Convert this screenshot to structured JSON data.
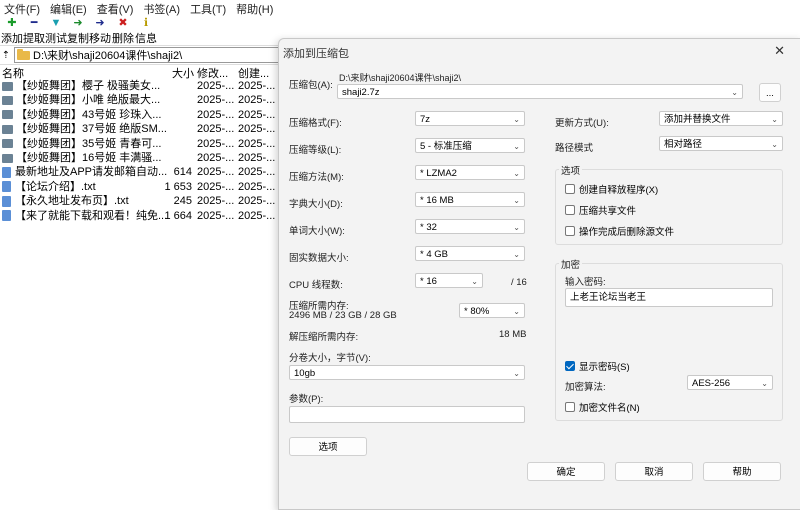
{
  "menu": [
    "文件(F)",
    "编辑(E)",
    "查看(V)",
    "书签(A)",
    "工具(T)",
    "帮助(H)"
  ],
  "toolbar": {
    "add": "添加",
    "extract": "提取",
    "test": "测试",
    "copy": "复制",
    "move": "移动",
    "delete": "删除",
    "info": "信息"
  },
  "address": "D:\\来财\\shaji20604课件\\shaji2\\",
  "list": {
    "headers": {
      "name": "名称",
      "size": "大小",
      "modified": "修改...",
      "created": "创建..."
    },
    "rows": [
      {
        "name": "【纱姬舞团】樱子 极骚美女...",
        "size": "",
        "modified": "2025-...",
        "created": "2025-...",
        "type": "folder"
      },
      {
        "name": "【纱姬舞团】小唯 绝版最大...",
        "size": "",
        "modified": "2025-...",
        "created": "2025-...",
        "type": "folder"
      },
      {
        "name": "【纱姬舞团】43号姬 珍珠入...",
        "size": "",
        "modified": "2025-...",
        "created": "2025-...",
        "type": "folder"
      },
      {
        "name": "【纱姬舞团】37号姬 绝版SM...",
        "size": "",
        "modified": "2025-...",
        "created": "2025-...",
        "type": "folder"
      },
      {
        "name": "【纱姬舞团】35号姬 青春可...",
        "size": "",
        "modified": "2025-...",
        "created": "2025-...",
        "type": "folder"
      },
      {
        "name": "【纱姬舞团】16号姬 丰满骚...",
        "size": "",
        "modified": "2025-...",
        "created": "2025-...",
        "type": "folder"
      },
      {
        "name": "最新地址及APP请发邮箱自动...",
        "size": "614",
        "modified": "2025-...",
        "created": "2025-...",
        "type": "file"
      },
      {
        "name": "【论坛介绍】.txt",
        "size": "1 653",
        "modified": "2025-...",
        "created": "2025-...",
        "type": "file"
      },
      {
        "name": "【永久地址发布页】.txt",
        "size": "245",
        "modified": "2025-...",
        "created": "2025-...",
        "type": "file"
      },
      {
        "name": "【来了就能下载和观看！纯免...",
        "size": "1 664",
        "modified": "2025-...",
        "created": "2025-...",
        "type": "file"
      }
    ]
  },
  "dialog": {
    "title": "添加到压缩包",
    "archive_label": "压缩包(A):",
    "archive_path": "D:\\来财\\shaji20604课件\\shaji2\\",
    "archive_name": "shaji2.7z",
    "browse": "...",
    "format_label": "压缩格式(F):",
    "format_value": "7z",
    "level_label": "压缩等级(L):",
    "level_value": "5 - 标准压缩",
    "method_label": "压缩方法(M):",
    "method_value": "*  LZMA2",
    "dict_label": "字典大小(D):",
    "dict_value": "*  16 MB",
    "word_label": "单词大小(W):",
    "word_value": "*  32",
    "solid_label": "固实数据大小:",
    "solid_value": "*  4 GB",
    "cpu_label": "CPU 线程数:",
    "cpu_value": "*  16",
    "cpu_max": "/ 16",
    "mem_comp_label": "压缩所需内存:",
    "mem_comp_value": "2496 MB / 23 GB / 28 GB",
    "mem_percent": "* 80%",
    "mem_decomp_label": "解压缩所需内存:",
    "mem_decomp_value": "18 MB",
    "split_label": "分卷大小，字节(V):",
    "split_value": "10gb",
    "params_label": "参数(P):",
    "params_value": "",
    "options_button": "选项",
    "update_label": "更新方式(U):",
    "update_value": "添加并替换文件",
    "path_label": "路径模式",
    "path_value": "相对路径",
    "options_group": "选项",
    "opt_sfx": "创建自释放程序(X)",
    "opt_shared": "压缩共享文件",
    "opt_delete": "操作完成后删除源文件",
    "encrypt_group": "加密",
    "password_label": "输入密码:",
    "password_value": "上老王论坛当老王",
    "show_password": "显示密码(S)",
    "enc_method_label": "加密算法:",
    "enc_method_value": "AES-256",
    "enc_names": "加密文件名(N)",
    "ok": "确定",
    "cancel": "取消",
    "help": "帮助"
  }
}
